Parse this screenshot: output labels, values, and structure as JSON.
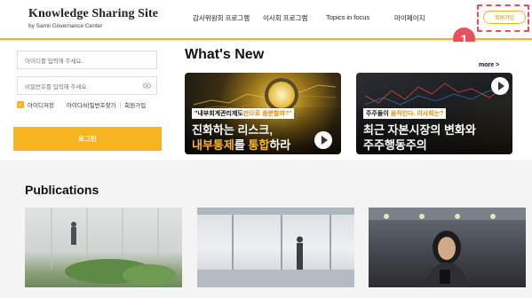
{
  "header": {
    "logo_title": "Knowledge Sharing Site",
    "logo_subtitle": "by Samil Governance Center",
    "nav": [
      {
        "label": "감사위원회 프로그램"
      },
      {
        "label": "이사회 프로그램"
      },
      {
        "label": "Topics in focus"
      },
      {
        "label": "마이페이지"
      }
    ],
    "signup_label": "회원가입",
    "step_badge": "1"
  },
  "login": {
    "id_placeholder": "아이디를 입력해 주세요.",
    "pw_placeholder": "비밀번호를 입력해 주세요.",
    "remember_label": "아이디저장",
    "find_label": "아이디/비밀번호찾기",
    "separator": "|",
    "signup_link": "회원가입",
    "login_button": "로그인"
  },
  "whats_new": {
    "title": "What's New",
    "more": "more >",
    "cards": [
      {
        "tag_pre": "\"내부회계관리제도",
        "tag_hl": "만으로 충분할까?\"",
        "line1": "진화하는 리스크,",
        "line2_hl1": "내부통제",
        "line2_mid": "를 ",
        "line2_hl2": "통합",
        "line2_post": "하라"
      },
      {
        "tag_pre": "주주들이 ",
        "tag_hl": "움직인다. 이사회는?",
        "line1": "최근 자본시장의 변화와",
        "line2": "주주행동주의"
      }
    ]
  },
  "publications": {
    "title": "Publications"
  },
  "colors": {
    "accent": "#f4b324",
    "badge": "#e8505b",
    "highlight_border": "#f04a55"
  }
}
